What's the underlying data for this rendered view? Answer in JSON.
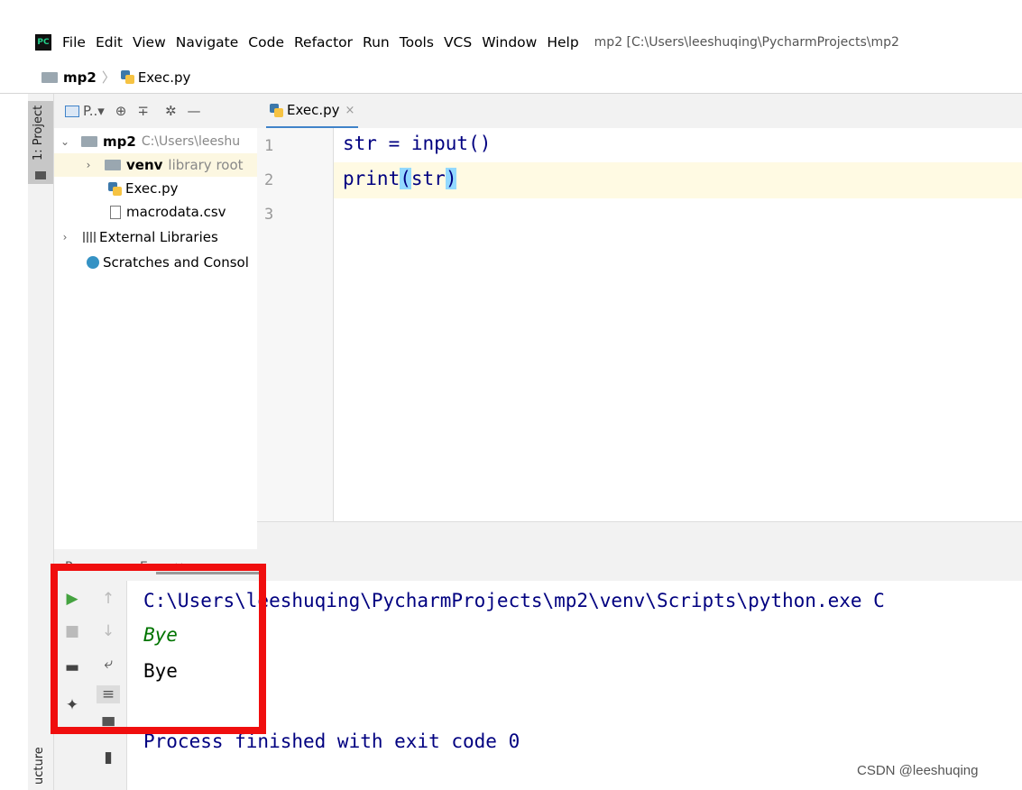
{
  "menubar": {
    "logo_text": "PC",
    "items": [
      "File",
      "Edit",
      "View",
      "Navigate",
      "Code",
      "Refactor",
      "Run",
      "Tools",
      "VCS",
      "Window",
      "Help"
    ],
    "window_title": "mp2 [C:\\Users\\leeshuqing\\PycharmProjects\\mp2"
  },
  "breadcrumb": {
    "project": "mp2",
    "file": "Exec.py",
    "separator": "〉"
  },
  "left_stripe": {
    "project_label": "1: Project",
    "structure_label": "ucture"
  },
  "project_toolbar": {
    "view_label": "P..▾"
  },
  "project_tree": {
    "root_name": "mp2",
    "root_path": "C:\\Users\\leeshu",
    "venv_name": "venv",
    "venv_note": "library root",
    "file_exec": "Exec.py",
    "file_csv": "macrodata.csv",
    "external_libraries": "External Libraries",
    "scratches": "Scratches and Consol"
  },
  "editor": {
    "tab_label": "Exec.py",
    "tab_close": "×",
    "line_numbers": [
      "1",
      "2",
      "3"
    ],
    "code_line_1": "str = input()",
    "code_line_2_pre": "print",
    "code_line_2_open": "(",
    "code_line_2_arg": "str",
    "code_line_2_close": ")"
  },
  "run_panel": {
    "header_label": "Run:",
    "tab_label": "Exec ×"
  },
  "console": {
    "command": "C:\\Users\\leeshuqing\\PycharmProjects\\mp2\\venv\\Scripts\\python.exe C",
    "input_echo": "Bye",
    "output": "Bye",
    "finish": "Process finished with exit code 0"
  },
  "colors": {
    "highlight_box": "#f00e0e",
    "console_text": "#000080",
    "input_echo": "#007400",
    "run_green": "#45a340"
  },
  "watermark": "CSDN @leeshuqing"
}
